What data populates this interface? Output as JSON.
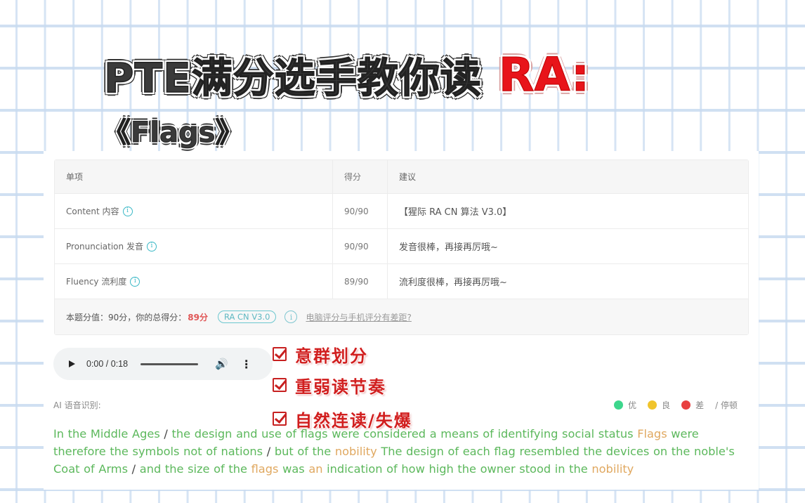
{
  "title": {
    "main": "PTE满分选手教你读",
    "tag": "RA:",
    "subtitle": "《Flags》"
  },
  "score_table": {
    "headers": [
      "单项",
      "得分",
      "建议"
    ],
    "rows": [
      {
        "item": "Content 内容",
        "score": "90/90",
        "advice": "【猩际 RA CN 算法 V3.0】"
      },
      {
        "item": "Pronunciation 发音",
        "score": "90/90",
        "advice": "发音很棒，再接再厉哦~"
      },
      {
        "item": "Fluency 流利度",
        "score": "89/90",
        "advice": "流利度很棒，再接再厉哦~"
      }
    ],
    "summary": {
      "prefix": "本题分值：90分，你的总得分：",
      "total": "89分",
      "version_pill": "RA CN V3.0",
      "link": "电脑评分与手机评分有差距?"
    }
  },
  "audio_player": {
    "time": "0:00 / 0:18",
    "progress": 0
  },
  "checklist": [
    "意群划分",
    "重弱读节奏",
    "自然连读/失爆"
  ],
  "ai_section": {
    "label": "AI 语音识别:",
    "legend": [
      {
        "label": "优",
        "color": "#3dd68c"
      },
      {
        "label": "良",
        "color": "#f0c42c"
      },
      {
        "label": "差",
        "color": "#e84040"
      }
    ],
    "pause_label": "/ 停顿"
  },
  "transcript": [
    {
      "t": "In the Middle Ages ",
      "c": "good"
    },
    {
      "t": "/ ",
      "c": "pause"
    },
    {
      "t": "the design and use of flags were considered a means of identifying social status ",
      "c": "good"
    },
    {
      "t": "Flags ",
      "c": "ok"
    },
    {
      "t": "were therefore the symbols not of nations ",
      "c": "good"
    },
    {
      "t": "/ ",
      "c": "pause"
    },
    {
      "t": "but of the ",
      "c": "good"
    },
    {
      "t": "nobility ",
      "c": "ok"
    },
    {
      "t": "The design of each flag resembled the devices on the noble's Coat of Arms ",
      "c": "good"
    },
    {
      "t": "/ ",
      "c": "pause"
    },
    {
      "t": "and the size of the ",
      "c": "good"
    },
    {
      "t": "flags ",
      "c": "ok"
    },
    {
      "t": "was ",
      "c": "good"
    },
    {
      "t": "an ",
      "c": "ok"
    },
    {
      "t": "indication of how high the owner stood in the ",
      "c": "good"
    },
    {
      "t": "nobility",
      "c": "ok"
    }
  ]
}
